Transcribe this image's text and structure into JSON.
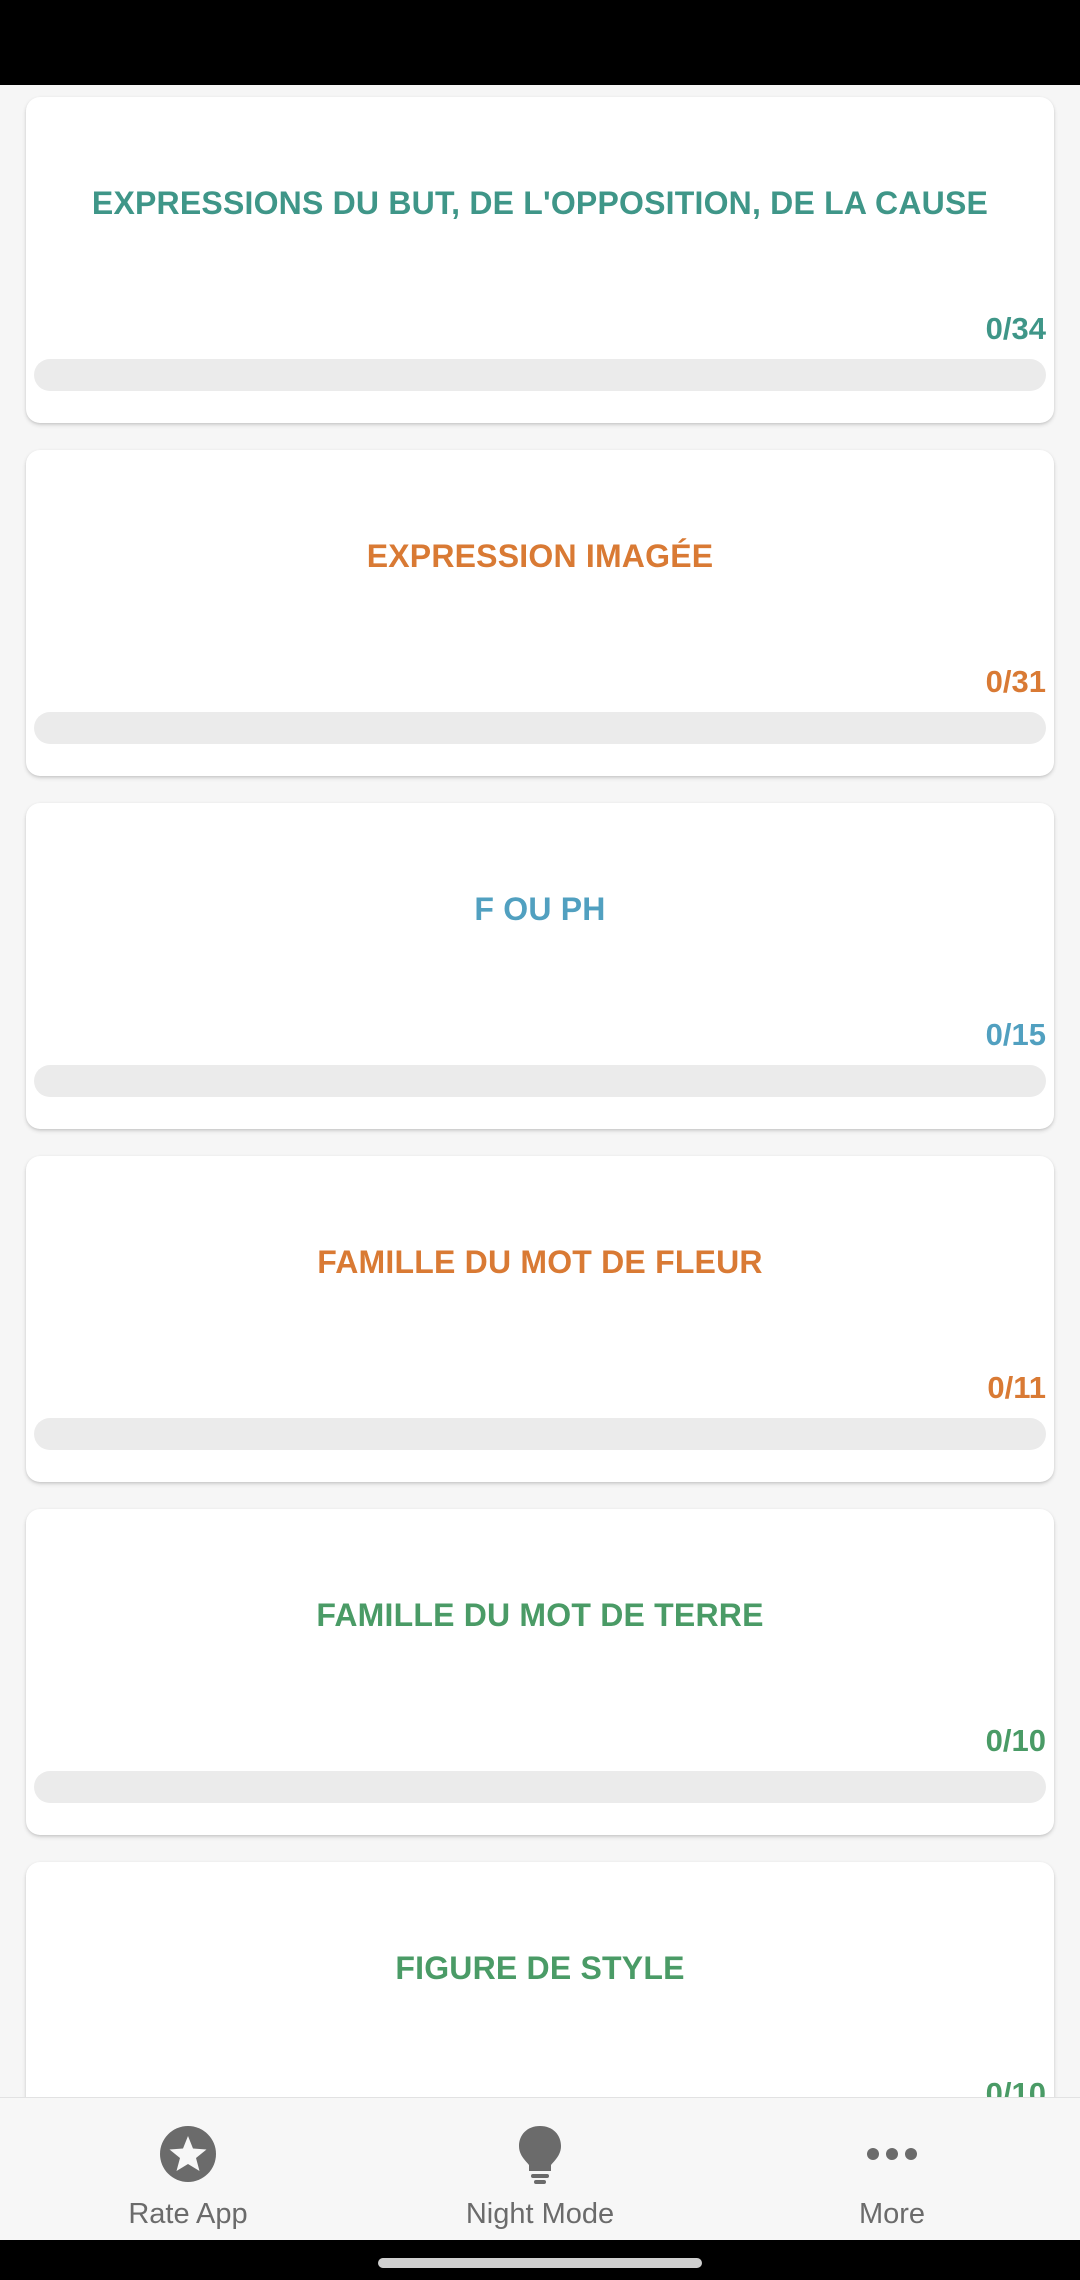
{
  "cards": [
    {
      "title": "EXPRESSIONS DU BUT, DE L'OPPOSITION, DE LA CAUSE",
      "count": "0/34",
      "progress": 0,
      "color": "#3f9688"
    },
    {
      "title": "EXPRESSION IMAGÉE",
      "count": "0/31",
      "progress": 0,
      "color": "#d97a34"
    },
    {
      "title": "F OU PH",
      "count": "0/15",
      "progress": 0,
      "color": "#51a0c0"
    },
    {
      "title": "FAMILLE DU MOT DE FLEUR",
      "count": "0/11",
      "progress": 0,
      "color": "#d97a34"
    },
    {
      "title": "FAMILLE DU MOT DE TERRE",
      "count": "0/10",
      "progress": 0,
      "color": "#4a9b66"
    },
    {
      "title": "FIGURE DE STYLE",
      "count": "0/10",
      "progress": 0,
      "color": "#4a9b66"
    }
  ],
  "bottom_nav": {
    "rate_label": "Rate App",
    "night_label": "Night Mode",
    "more_label": "More",
    "icon_color": "#6b6b6b"
  }
}
